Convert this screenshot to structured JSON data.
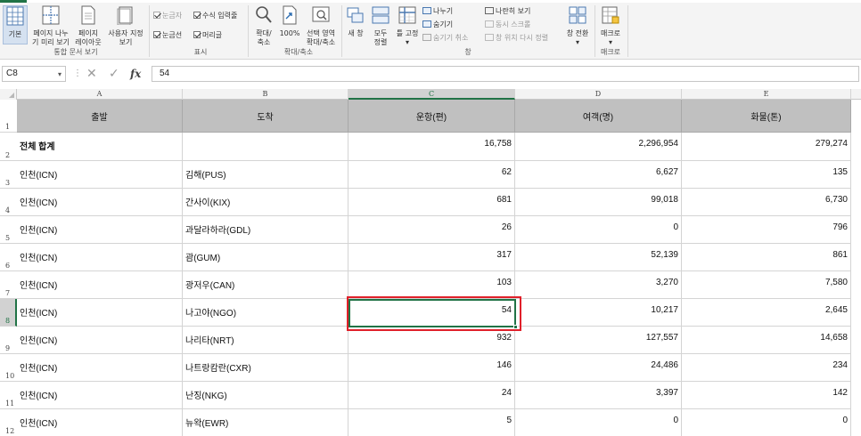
{
  "ribbon": {
    "groups": {
      "workbook_views": "통합 문서 보기",
      "show": "표시",
      "zoom": "확대/축소",
      "window": "창",
      "macros": "매크로"
    },
    "normal_btn": "기본",
    "page_break_btn": [
      "페이지 나누",
      "기 미리 보기"
    ],
    "page_layout_btn": [
      "페이지",
      "레이아웃"
    ],
    "custom_views_btn": [
      "사용자 지정",
      "보기"
    ],
    "ruler_chk": "눈금자",
    "formula_bar_chk": "수식 입력줄",
    "gridlines_chk": "눈금선",
    "headings_chk": "머리글",
    "zoom_btn": [
      "확대/",
      "축소"
    ],
    "zoom100_btn": "100%",
    "zoom_selection_btn": [
      "선택 영역",
      "확대/축소"
    ],
    "new_window_btn": "새 창",
    "arrange_all_btn": [
      "모두",
      "정렬"
    ],
    "freeze_panes_btn": [
      "틀 고정",
      "▾"
    ],
    "split_item": "나누기",
    "hide_item": "숨기기",
    "unhide_item": "숨기기 취소",
    "side_by_side_item": "나란히 보기",
    "sync_scroll_item": "동시 스크롤",
    "reset_position_item": "창 위치 다시 정렬",
    "switch_windows_btn": [
      "창 전환",
      "▾"
    ],
    "macros_btn": [
      "매크로",
      "▾"
    ]
  },
  "formula_bar": {
    "name_box": "C8",
    "fx": "fx",
    "cancel_icon": "✕",
    "enter_icon": "✓",
    "value": "54"
  },
  "sheet": {
    "column_letters": [
      "A",
      "B",
      "C",
      "D",
      "E"
    ],
    "row_numbers": [
      "1",
      "2",
      "3",
      "4",
      "5",
      "6",
      "7",
      "8",
      "9",
      "10",
      "11",
      "12"
    ],
    "header": [
      "출발",
      "도착",
      "운항(편)",
      "여객(명)",
      "화물(톤)"
    ],
    "rows": [
      [
        "전체 합계",
        "",
        "16,758",
        "2,296,954",
        "279,274"
      ],
      [
        "인천(ICN)",
        "김해(PUS)",
        "62",
        "6,627",
        "135"
      ],
      [
        "인천(ICN)",
        "간사이(KIX)",
        "681",
        "99,018",
        "6,730"
      ],
      [
        "인천(ICN)",
        "과달라하라(GDL)",
        "26",
        "0",
        "796"
      ],
      [
        "인천(ICN)",
        "괌(GUM)",
        "317",
        "52,139",
        "861"
      ],
      [
        "인천(ICN)",
        "광저우(CAN)",
        "103",
        "3,270",
        "7,580"
      ],
      [
        "인천(ICN)",
        "나고야(NGO)",
        "54",
        "10,217",
        "2,645"
      ],
      [
        "인천(ICN)",
        "나리타(NRT)",
        "932",
        "127,557",
        "14,658"
      ],
      [
        "인천(ICN)",
        "나트랑캄란(CXR)",
        "146",
        "24,486",
        "234"
      ],
      [
        "인천(ICN)",
        "난징(NKG)",
        "24",
        "3,397",
        "142"
      ],
      [
        "인천(ICN)",
        "뉴왁(EWR)",
        "5",
        "0",
        "0"
      ]
    ]
  },
  "colors": {
    "accent": "#217346",
    "highlight": "#e0202a",
    "header_fill": "#c0c0c0"
  }
}
